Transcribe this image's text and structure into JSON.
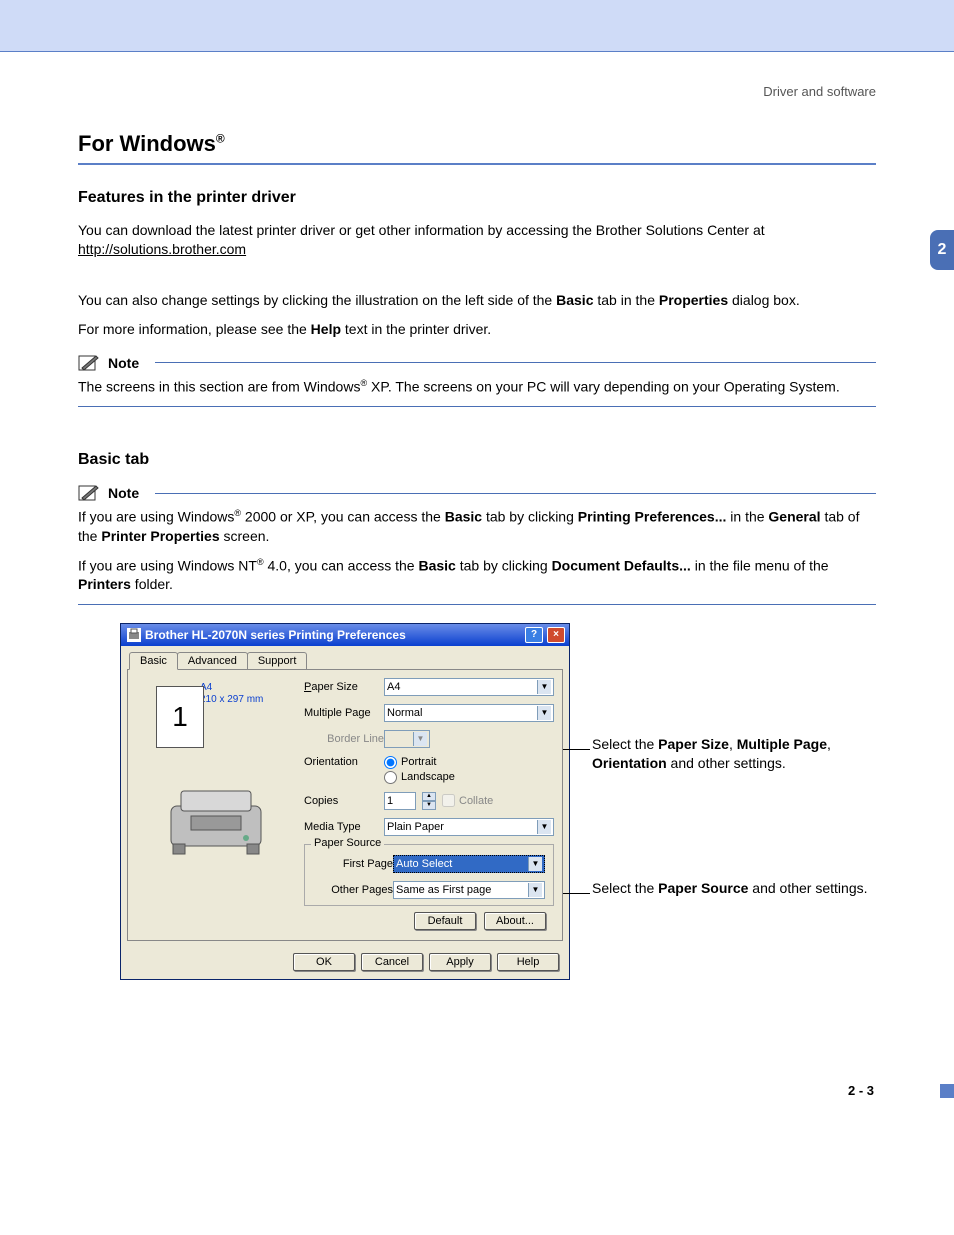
{
  "breadcrumb": "Driver and software",
  "chapter_number": "2",
  "h1_pre": "For Windows",
  "h1_sup": "®",
  "h2_features": "Features in the printer driver",
  "p1_a": "You can download the latest printer driver or get other information by accessing the Brother Solutions Center at ",
  "p1_link": "http://solutions.brother.com",
  "p2_a": "You can also change settings by clicking the illustration on the left side of the ",
  "p2_b": "Basic",
  "p2_c": " tab in the ",
  "p2_d": "Properties",
  "p2_e": " dialog box.",
  "p3_a": "For more information, please see the ",
  "p3_b": "Help",
  "p3_c": " text in the printer driver.",
  "note_label": "Note",
  "note1_a": "The screens in this section are from Windows",
  "note1_sup": "®",
  "note1_b": " XP. The screens on your PC will vary depending on your Operating System.",
  "h2_basic": "Basic tab",
  "note2_a": "If you are using Windows",
  "note2_sup1": "®",
  "note2_b": " 2000 or XP, you can access the ",
  "note2_c": "Basic",
  "note2_d": " tab by clicking ",
  "note2_e": "Printing Preferences...",
  "note2_f": " in the ",
  "note2_g": "General",
  "note2_h": " tab of the ",
  "note2_i": "Printer Properties",
  "note2_j": " screen.",
  "note3_a": "If you are using Windows NT",
  "note3_sup": "®",
  "note3_b": " 4.0, you can access the ",
  "note3_c": "Basic",
  "note3_d": " tab by clicking ",
  "note3_e": "Document Defaults...",
  "note3_f": " in the file menu of the ",
  "note3_g": "Printers",
  "note3_h": " folder.",
  "dialog": {
    "title": "Brother HL-2070N series Printing Preferences",
    "help_btn": "?",
    "close_btn": "×",
    "tabs": {
      "basic": "Basic",
      "advanced": "Advanced",
      "support": "Support"
    },
    "paper_spec_name": "A4",
    "paper_spec_dim": "210 x 297 mm",
    "pageframe_num": "1",
    "labels": {
      "paper_size": "Paper Size",
      "multiple_page": "Multiple Page",
      "border_line": "Border Line",
      "orientation": "Orientation",
      "copies": "Copies",
      "media_type": "Media Type",
      "paper_source": "Paper Source",
      "first_page": "First Page",
      "other_pages": "Other Pages"
    },
    "values": {
      "paper_size": "A4",
      "multiple_page": "Normal",
      "border_line": "",
      "portrait": "Portrait",
      "landscape": "Landscape",
      "copies": "1",
      "collate": "Collate",
      "media_type": "Plain Paper",
      "first_page": "Auto Select",
      "other_pages": "Same as First page"
    },
    "buttons": {
      "default": "Default",
      "about": "About...",
      "ok": "OK",
      "cancel": "Cancel",
      "apply": "Apply",
      "help": "Help"
    }
  },
  "callout1_a": "Select the ",
  "callout1_b": "Paper Size",
  "callout1_c": ", ",
  "callout1_d": "Multiple Page",
  "callout1_e": ", ",
  "callout1_f": "Orientation",
  "callout1_g": " and other settings.",
  "callout2_a": "Select the ",
  "callout2_b": "Paper Source",
  "callout2_c": " and other settings.",
  "page_number": "2 - 3"
}
